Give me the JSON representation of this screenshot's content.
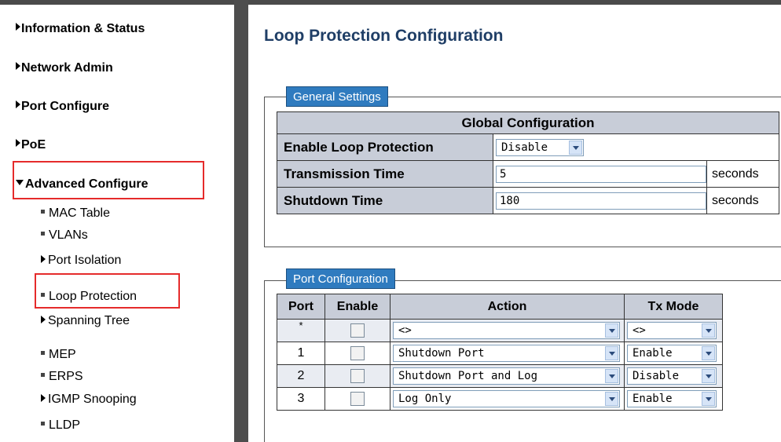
{
  "sidebar": {
    "items": [
      {
        "label": "Information & Status"
      },
      {
        "label": "Network Admin"
      },
      {
        "label": "Port Configure"
      },
      {
        "label": "PoE"
      },
      {
        "label": "Advanced Configure"
      }
    ],
    "subitems": [
      {
        "label": "MAC Table"
      },
      {
        "label": "VLANs"
      },
      {
        "label": "Port Isolation"
      },
      {
        "label": "Loop Protection"
      },
      {
        "label": "Spanning Tree"
      },
      {
        "label": "MEP"
      },
      {
        "label": "ERPS"
      },
      {
        "label": "IGMP Snooping"
      },
      {
        "label": "LLDP"
      }
    ]
  },
  "page": {
    "title": "Loop Protection Configuration"
  },
  "general": {
    "legend": "General Settings",
    "header": "Global Configuration",
    "enable_label": "Enable Loop Protection",
    "enable_value": "Disable",
    "tx_label": "Transmission Time",
    "tx_value": "5",
    "tx_unit": "seconds",
    "shutdown_label": "Shutdown Time",
    "shutdown_value": "180",
    "shutdown_unit": "seconds"
  },
  "ports": {
    "legend": "Port Configuration",
    "headers": {
      "port": "Port",
      "enable": "Enable",
      "action": "Action",
      "txmode": "Tx Mode"
    },
    "rows": [
      {
        "port": "*",
        "action": "<>",
        "txmode": "<>"
      },
      {
        "port": "1",
        "action": "Shutdown Port",
        "txmode": "Enable"
      },
      {
        "port": "2",
        "action": "Shutdown Port and Log",
        "txmode": "Disable"
      },
      {
        "port": "3",
        "action": "Log Only",
        "txmode": "Enable"
      }
    ]
  },
  "colors": {
    "accent": "#2f7bbf",
    "header_bg": "#c8cdd8",
    "title": "#1f3e66",
    "highlight": "#e52b2b"
  }
}
